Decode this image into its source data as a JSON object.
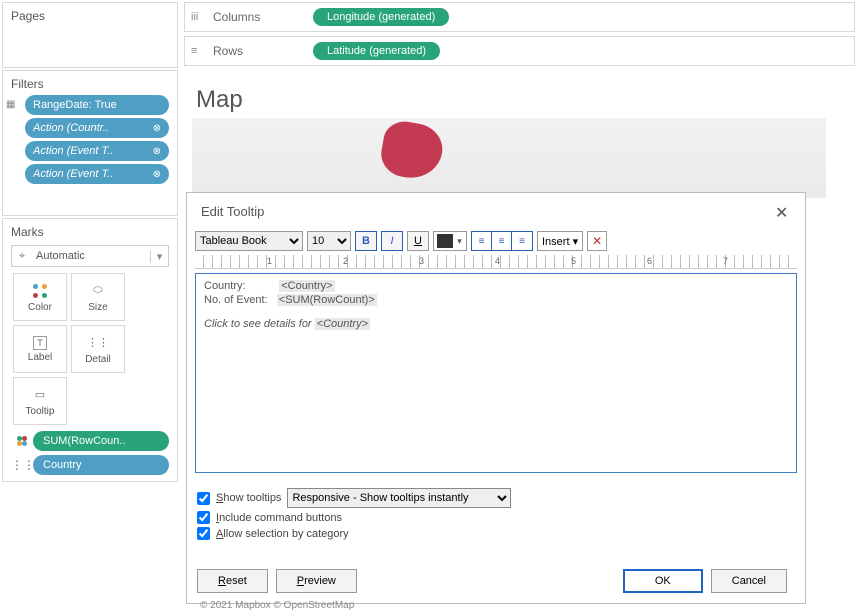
{
  "sidebar": {
    "pages_title": "Pages",
    "filters_title": "Filters",
    "filters": [
      {
        "label": "RangeDate: True",
        "italic": false,
        "icon": ""
      },
      {
        "label": "Action (Countr..",
        "italic": true,
        "icon": "⊗"
      },
      {
        "label": "Action (Event T..",
        "italic": true,
        "icon": "⊗"
      },
      {
        "label": "Action (Event T..",
        "italic": true,
        "icon": "⊗"
      }
    ],
    "marks_title": "Marks",
    "marks_type": "Automatic",
    "cards": [
      "Color",
      "Size",
      "Label",
      "Detail",
      "Tooltip"
    ],
    "mark_rows": [
      {
        "icon": "◦◦",
        "label": "SUM(RowCoun..",
        "color": "green"
      },
      {
        "icon": "⋮⋮",
        "label": "Country",
        "color": "blue"
      }
    ]
  },
  "shelves": {
    "columns_label": "Columns",
    "columns_pill": "Longitude (generated)",
    "rows_label": "Rows",
    "rows_pill": "Latitude (generated)"
  },
  "view": {
    "title": "Map"
  },
  "dialog": {
    "title": "Edit Tooltip",
    "font_name": "Tableau Book",
    "font_size": "10",
    "insert_label": "Insert ▾",
    "btn_bold": "B",
    "btn_italic": "I",
    "btn_underline": "U",
    "ruler_numbers": [
      "1",
      "2",
      "3",
      "4",
      "5",
      "6",
      "7"
    ],
    "editor": {
      "l1_label": "Country:",
      "l1_field": "<Country>",
      "l2_label": "No. of Event:",
      "l2_field": "<SUM(RowCount)>",
      "l3_text": "Click to see details for ",
      "l3_field": "<Country>"
    },
    "opt_show": "how tooltips",
    "opt_show_u": "S",
    "opt_mode": "Responsive - Show tooltips instantly",
    "opt_include": "nclude command buttons",
    "opt_include_u": "I",
    "opt_allow": "llow selection by category",
    "opt_allow_u": "A",
    "btn_reset": "Reset",
    "btn_reset_u": "R",
    "btn_preview": "Preview",
    "btn_preview_u": "P",
    "btn_ok": "OK",
    "btn_cancel": "Cancel"
  },
  "footer": "© 2021 Mapbox © OpenStreetMap"
}
